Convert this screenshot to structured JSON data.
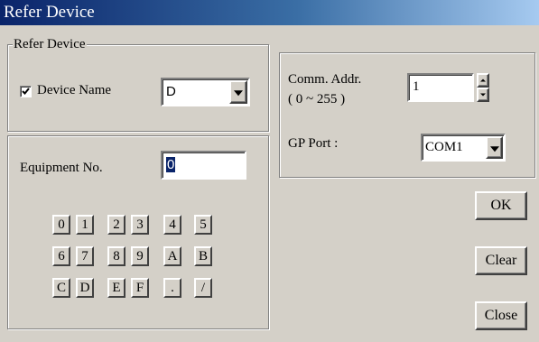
{
  "window": {
    "title": "Refer Device"
  },
  "refer_device": {
    "legend": "Refer Device",
    "device_name_label": "Device Name",
    "device_name_checked": true,
    "device_value": "D"
  },
  "equipment": {
    "label": "Equipment No.",
    "value": "0"
  },
  "keypad": {
    "rows": [
      [
        "0",
        "1",
        "2",
        "3",
        "4",
        "5"
      ],
      [
        "6",
        "7",
        "8",
        "9",
        "A",
        "B"
      ],
      [
        "C",
        "D",
        "E",
        "F",
        ".",
        "/"
      ]
    ]
  },
  "comm": {
    "addr_label": "Comm. Addr.",
    "range_label": "( 0 ~ 255 )",
    "addr_value": "1",
    "gp_port_label": "GP Port :",
    "gp_port_value": "COM1"
  },
  "buttons": {
    "ok": "OK",
    "clear": "Clear",
    "close": "Close"
  }
}
